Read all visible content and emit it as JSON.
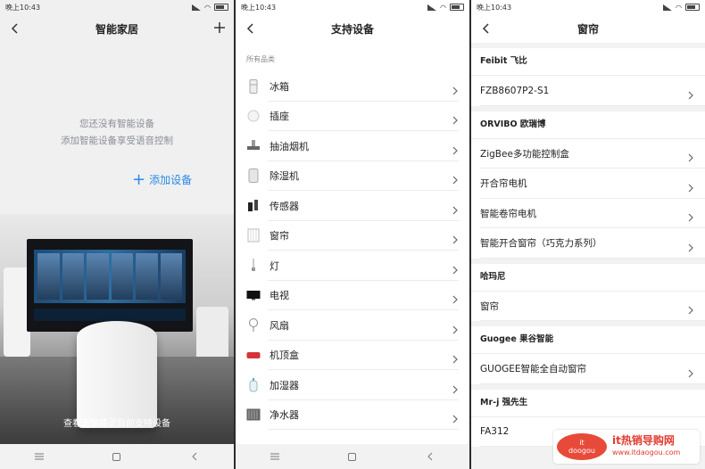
{
  "status": {
    "time": "晚上10:43"
  },
  "screen1": {
    "title": "智能家居",
    "empty_line1": "您还没有智能设备",
    "empty_line2": "添加智能设备享受语音控制",
    "add_device": "添加设备",
    "bottom_link": "查看天猫精灵目前支持设备"
  },
  "screen2": {
    "title": "支持设备",
    "section": "所有品类",
    "categories": [
      {
        "label": "冰箱",
        "icon": "fridge-icon"
      },
      {
        "label": "插座",
        "icon": "socket-icon"
      },
      {
        "label": "抽油烟机",
        "icon": "range-hood-icon"
      },
      {
        "label": "除湿机",
        "icon": "dehumidifier-icon"
      },
      {
        "label": "传感器",
        "icon": "sensor-icon"
      },
      {
        "label": "窗帘",
        "icon": "curtain-icon"
      },
      {
        "label": "灯",
        "icon": "lamp-icon"
      },
      {
        "label": "电视",
        "icon": "tv-icon"
      },
      {
        "label": "风扇",
        "icon": "fan-icon"
      },
      {
        "label": "机顶盒",
        "icon": "settop-box-icon"
      },
      {
        "label": "加湿器",
        "icon": "humidifier-icon"
      },
      {
        "label": "净水器",
        "icon": "water-purifier-icon"
      }
    ]
  },
  "screen3": {
    "title": "窗帘",
    "brands": [
      {
        "name": "Feibit 飞比",
        "devices": [
          "FZB8607P2-S1"
        ]
      },
      {
        "name": "ORVIBO 欧瑞博",
        "devices": [
          "ZigBee多功能控制盒",
          "开合帘电机",
          "智能卷帘电机",
          "智能开合窗帘（巧克力系列）"
        ]
      },
      {
        "name": "哈玛尼",
        "devices": [
          "窗帘"
        ]
      },
      {
        "name": "Guogee 果谷智能",
        "devices": [
          "GUOGEE智能全自动窗帘"
        ]
      },
      {
        "name": "Mr-j 强先生",
        "devices": [
          "FA312"
        ]
      }
    ]
  },
  "watermark": {
    "logo_top": "it",
    "logo_bottom": "doogou",
    "text": "it热销导购网",
    "url": "www.itdaogou.com"
  },
  "colors": {
    "accent": "#2b8ae8",
    "watermark": "#e23b2e"
  }
}
